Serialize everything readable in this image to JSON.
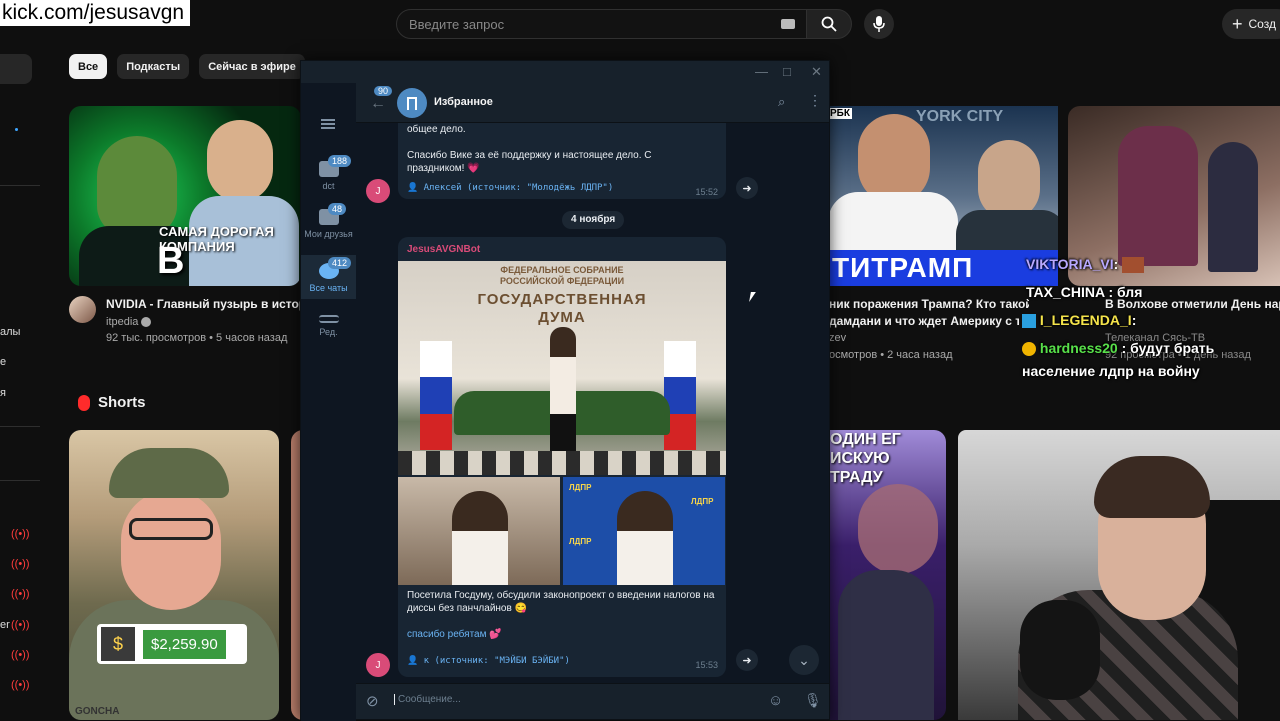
{
  "overlay": {
    "watermark": "kick.com/jesusavgn"
  },
  "youtube": {
    "search_placeholder": "Введите запрос",
    "create_label": "Созд",
    "chips": [
      "Все",
      "Подкасты",
      "Сейчас в эфире"
    ],
    "sidebar_fragments": [
      "алы",
      "е",
      "я",
      "er"
    ],
    "videos": [
      {
        "title": "NVIDIA - Главный пузырь в истори",
        "channel": "itpedia",
        "meta": "92 тыс. просмотров • 5 часов назад",
        "thumb_caption": "САМАЯ ДОРОГАЯ КОМПАНИЯ",
        "thumb_big": "В ИСТОРИИ"
      },
      {
        "title_line1": "ник поражения Трампа? Кто такой",
        "title_line2": "дамдани и что ждет Америку с так",
        "channel": "zev",
        "meta": "осмотров • 2 часа назад",
        "thumb_rbk": "РБК",
        "thumb_city": "YORK CITY",
        "thumb_strip": "ТИТРАМП"
      },
      {
        "title": "В Волхове отметили День наро",
        "channel": "Телеканал Сясь-ТВ",
        "meta": "92 просмотра • 1 день назад"
      }
    ],
    "shorts_title": "Shorts",
    "shorts": [
      {
        "amount": "$2,259.90",
        "name_tag": "GONCHA"
      },
      {
        "text": "ОДИН ЕГ\nИСКУЮ\nТРАДУ"
      }
    ]
  },
  "chat": [
    {
      "user": "VIKTORIA_VI",
      "text": ":",
      "color": "#b9a9ff"
    },
    {
      "user": "TAX_CHINA",
      "text": ": бля",
      "color": "#ffffff"
    },
    {
      "user": "I_LEGENDA_I",
      "text": ":",
      "color": "#f5e44b"
    },
    {
      "user": "hardness20",
      "text": ": будут брать",
      "color": "#58e04a"
    },
    {
      "user": "",
      "text": "население лдпр на войну",
      "color": "#ffffff"
    }
  ],
  "telegram": {
    "chat_title": "Избранное",
    "back_count": "90",
    "folders": [
      {
        "label": "dct",
        "badge": "188"
      },
      {
        "label": "Мои друзья",
        "badge": "48"
      },
      {
        "label": "Все чаты",
        "badge": "412"
      },
      {
        "label": "Ред.",
        "badge": ""
      }
    ],
    "messages": [
      {
        "text_top": "общее дело.",
        "text": "Спасибо Вике за её поддержку и настоящее дело. С праздником! 💗",
        "forward": "👤 Алексей (источник: \"Молодёжь ЛДПР\")",
        "time": "15:52",
        "avatar": "J"
      },
      {
        "sender": "JesusAVGNBot",
        "photo_header1": "ФЕДЕРАЛЬНОЕ СОБРАНИЕ",
        "photo_header1b": "РОССИЙСКОЙ ФЕДЕРАЦИИ",
        "photo_header2": "ГОСУДАРСТВЕННАЯ",
        "photo_header3": "ДУМА",
        "photo_ldpr": "ЛДПР",
        "text": "Посетила Госдуму, обсудили законопроект о введении налогов на диссы без панчлайнов 😋",
        "thanks": "спасибо ребятам 💕",
        "forward": "👤 к (источник: \"МЭЙБИ БЭЙБИ\")",
        "time": "15:53",
        "avatar": "J"
      }
    ],
    "date_separator": "4 ноября",
    "input_placeholder": "Сообщение..."
  }
}
